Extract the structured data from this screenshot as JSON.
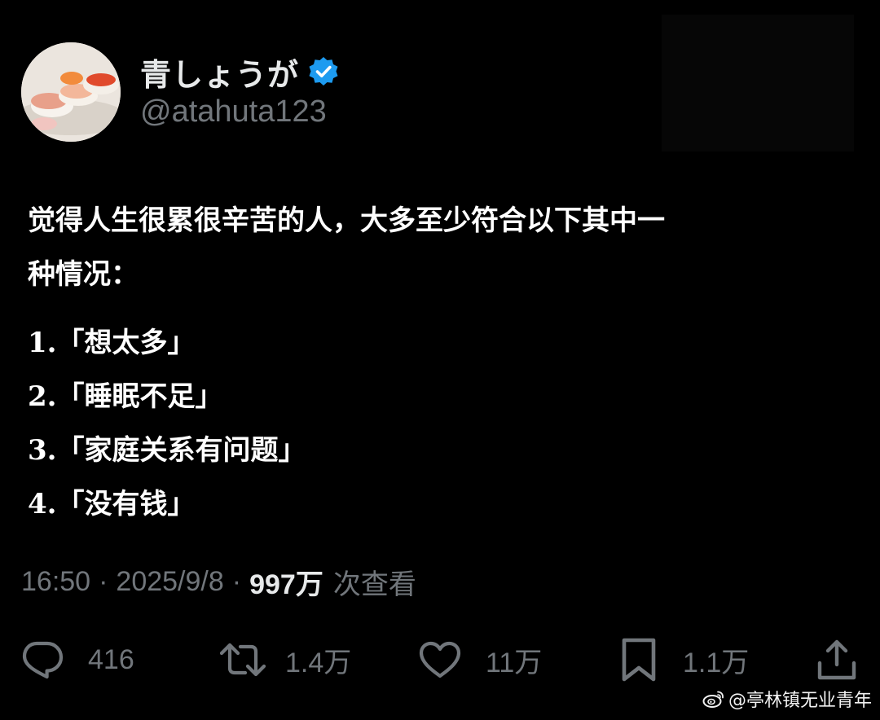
{
  "author": {
    "display_name": "青しょうが",
    "handle": "@atahuta123",
    "verified": true,
    "verified_color": "#1d9bf0"
  },
  "tweet": {
    "intro_line1": "觉得人生很累很辛苦的人，大多至少符合以下其中一",
    "intro_line2": "种情况：",
    "items": [
      "1.「想太多」",
      "2.「睡眠不足」",
      "3.「家庭关系有问题」",
      "4.「没有钱」"
    ]
  },
  "meta": {
    "time": "16:50",
    "separator": "·",
    "date": "2025/9/8",
    "views_count": "997万",
    "views_label": "次查看"
  },
  "actions": {
    "replies": "416",
    "reposts": "1.4万",
    "likes": "11万",
    "bookmarks": "1.1万"
  },
  "watermark": {
    "text": "@亭林镇无业青年"
  },
  "icons": {
    "reply": "reply-icon",
    "repost": "repost-icon",
    "like": "heart-icon",
    "bookmark": "bookmark-icon",
    "share": "share-icon",
    "verified": "verified-badge-icon",
    "weibo": "weibo-logo-icon"
  }
}
